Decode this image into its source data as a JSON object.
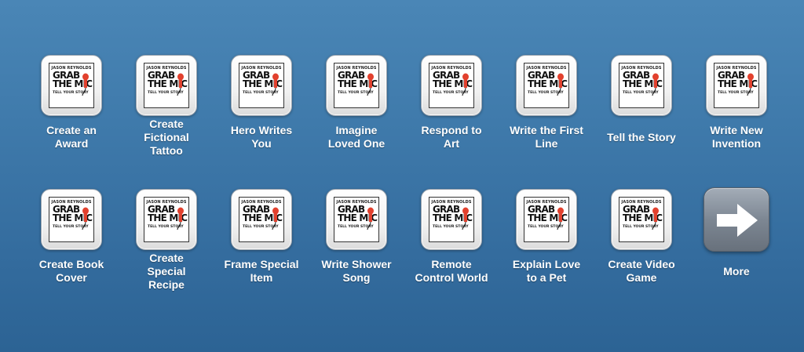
{
  "brand": {
    "author": "JASON REYNOLDS",
    "line1": "GRAB",
    "line2": "THE MIC",
    "tagline": "TELL YOUR STORY",
    "accent_color": "#e2412e"
  },
  "rows": [
    {
      "items": [
        {
          "label": "Create an\nAward"
        },
        {
          "label": "Create\nFictional\nTattoo"
        },
        {
          "label": "Hero Writes\nYou"
        },
        {
          "label": "Imagine\nLoved One"
        },
        {
          "label": "Respond to\nArt"
        },
        {
          "label": "Write the First\nLine"
        },
        {
          "label": "Tell the Story"
        },
        {
          "label": "Write New\nInvention"
        }
      ]
    },
    {
      "items": [
        {
          "label": "Create Book\nCover"
        },
        {
          "label": "Create\nSpecial\nRecipe"
        },
        {
          "label": "Frame Special\nItem"
        },
        {
          "label": "Write Shower\nSong"
        },
        {
          "label": "Remote\nControl World"
        },
        {
          "label": "Explain Love\nto a Pet"
        },
        {
          "label": "Create Video\nGame"
        }
      ]
    }
  ],
  "more": {
    "label": "More",
    "icon": "right-arrow-icon"
  }
}
